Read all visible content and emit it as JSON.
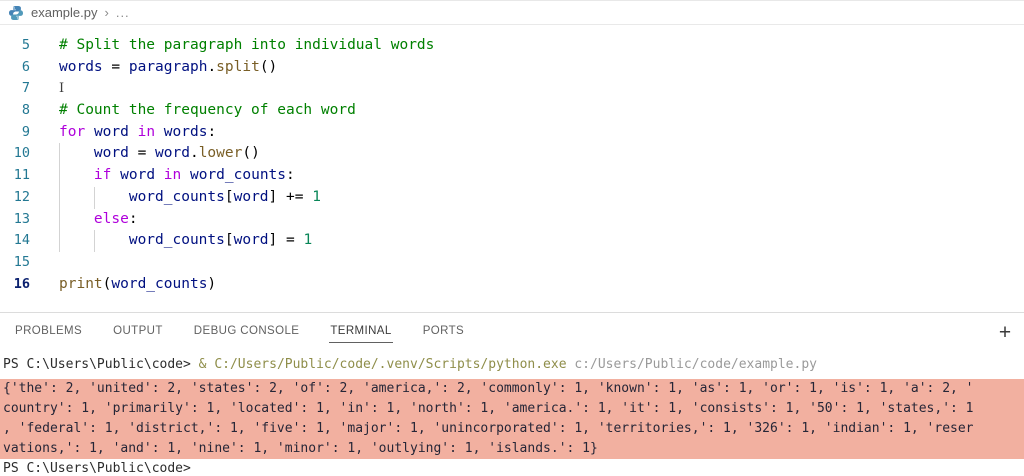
{
  "breadcrumb": {
    "file_name": "example.py",
    "separator": "›",
    "ellipsis": "..."
  },
  "editor": {
    "active_line": 16,
    "lines": [
      {
        "num": "5",
        "guides": [],
        "tokens": [
          [
            "comment",
            "# Split the paragraph into individual words"
          ]
        ]
      },
      {
        "num": "6",
        "guides": [],
        "tokens": [
          [
            "var",
            "words"
          ],
          [
            "plain",
            " "
          ],
          [
            "op",
            "="
          ],
          [
            "plain",
            " "
          ],
          [
            "var",
            "paragraph"
          ],
          [
            "plain",
            "."
          ],
          [
            "func",
            "split"
          ],
          [
            "plain",
            "()"
          ]
        ]
      },
      {
        "num": "7",
        "guides": [],
        "cursor": true,
        "tokens": []
      },
      {
        "num": "8",
        "guides": [],
        "tokens": [
          [
            "comment",
            "# Count the frequency of each word"
          ]
        ]
      },
      {
        "num": "9",
        "guides": [],
        "tokens": [
          [
            "kw",
            "for"
          ],
          [
            "plain",
            " "
          ],
          [
            "var",
            "word"
          ],
          [
            "plain",
            " "
          ],
          [
            "kw",
            "in"
          ],
          [
            "plain",
            " "
          ],
          [
            "var",
            "words"
          ],
          [
            "plain",
            ":"
          ]
        ]
      },
      {
        "num": "10",
        "guides": [
          0
        ],
        "tokens": [
          [
            "plain",
            "    "
          ],
          [
            "var",
            "word"
          ],
          [
            "plain",
            " "
          ],
          [
            "op",
            "="
          ],
          [
            "plain",
            " "
          ],
          [
            "var",
            "word"
          ],
          [
            "plain",
            "."
          ],
          [
            "func",
            "lower"
          ],
          [
            "plain",
            "()"
          ]
        ]
      },
      {
        "num": "11",
        "guides": [
          0
        ],
        "tokens": [
          [
            "plain",
            "    "
          ],
          [
            "kw",
            "if"
          ],
          [
            "plain",
            " "
          ],
          [
            "var",
            "word"
          ],
          [
            "plain",
            " "
          ],
          [
            "kw",
            "in"
          ],
          [
            "plain",
            " "
          ],
          [
            "var",
            "word_counts"
          ],
          [
            "plain",
            ":"
          ]
        ]
      },
      {
        "num": "12",
        "guides": [
          0,
          4
        ],
        "tokens": [
          [
            "plain",
            "        "
          ],
          [
            "var",
            "word_counts"
          ],
          [
            "plain",
            "["
          ],
          [
            "var",
            "word"
          ],
          [
            "plain",
            "] "
          ],
          [
            "op",
            "+="
          ],
          [
            "plain",
            " "
          ],
          [
            "num",
            "1"
          ]
        ]
      },
      {
        "num": "13",
        "guides": [
          0
        ],
        "tokens": [
          [
            "plain",
            "    "
          ],
          [
            "kw",
            "else"
          ],
          [
            "plain",
            ":"
          ]
        ]
      },
      {
        "num": "14",
        "guides": [
          0,
          4
        ],
        "tokens": [
          [
            "plain",
            "        "
          ],
          [
            "var",
            "word_counts"
          ],
          [
            "plain",
            "["
          ],
          [
            "var",
            "word"
          ],
          [
            "plain",
            "] "
          ],
          [
            "op",
            "="
          ],
          [
            "plain",
            " "
          ],
          [
            "num",
            "1"
          ]
        ]
      },
      {
        "num": "15",
        "guides": [],
        "tokens": []
      },
      {
        "num": "16",
        "guides": [],
        "tokens": [
          [
            "func",
            "print"
          ],
          [
            "plain",
            "("
          ],
          [
            "var",
            "word_counts"
          ],
          [
            "plain",
            ")"
          ]
        ]
      }
    ]
  },
  "panel": {
    "tabs": [
      {
        "label": "PROBLEMS",
        "active": false
      },
      {
        "label": "OUTPUT",
        "active": false
      },
      {
        "label": "DEBUG CONSOLE",
        "active": false
      },
      {
        "label": "TERMINAL",
        "active": true
      },
      {
        "label": "PORTS",
        "active": false
      }
    ],
    "new_terminal_label": "+"
  },
  "terminal": {
    "command": {
      "prompt": "PS C:\\Users\\Public\\code> ",
      "executable": "& C:/Users/Public/code/.venv/Scripts/python.exe ",
      "argument": "c:/Users/Public/code/example.py"
    },
    "output_lines": [
      "{'the': 2, 'united': 2, 'states': 2, 'of': 2, 'america,': 2, 'commonly': 1, 'known': 1, 'as': 1, 'or': 1, 'is': 1, 'a': 2, '",
      "country': 1, 'primarily': 1, 'located': 1, 'in': 1, 'north': 1, 'america.': 1, 'it': 1, 'consists': 1, '50': 1, 'states,': 1",
      ", 'federal': 1, 'district,': 1, 'five': 1, 'major': 1, 'unincorporated': 1, 'territories,': 1, '326': 1, 'indian': 1, 'reser",
      "vations,': 1, 'and': 1, 'nine': 1, 'minor': 1, 'outlying': 1, 'islands.': 1}"
    ],
    "new_prompt": "PS C:\\Users\\Public\\code>"
  },
  "colors": {
    "selection_highlight": "#f2b0a0",
    "python_icon_blue": "#4584b6",
    "python_icon_blue2": "#519aba"
  }
}
